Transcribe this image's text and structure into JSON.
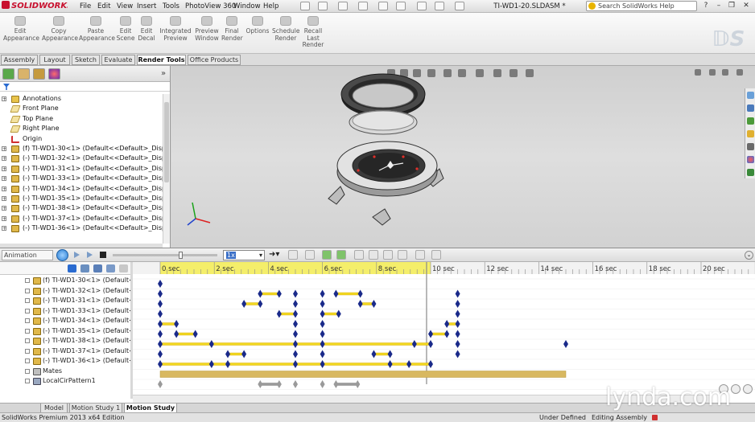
{
  "app": {
    "logo_text": "SOLIDWORKS",
    "document_title": "TI-WD1-20.SLDASM *",
    "help_search_placeholder": "Search SolidWorks Help",
    "menu": [
      "File",
      "Edit",
      "View",
      "Insert",
      "Tools",
      "PhotoView 360",
      "Window",
      "Help"
    ]
  },
  "command_manager": {
    "buttons": [
      {
        "label": "Edit\nAppearance",
        "icon": "edit-appearance-icon"
      },
      {
        "label": "Copy\nAppearance",
        "icon": "copy-appearance-icon"
      },
      {
        "label": "Paste\nAppearance",
        "icon": "paste-appearance-icon"
      },
      {
        "label": "Edit\nScene",
        "icon": "edit-scene-icon"
      },
      {
        "label": "Edit\nDecal",
        "icon": "edit-decal-icon"
      },
      {
        "label": "Integrated\nPreview",
        "icon": "integrated-preview-icon"
      },
      {
        "label": "Preview\nWindow",
        "icon": "preview-window-icon"
      },
      {
        "label": "Final\nRender",
        "icon": "final-render-icon"
      },
      {
        "label": "Options",
        "icon": "options-icon"
      },
      {
        "label": "Schedule\nRender",
        "icon": "schedule-render-icon"
      },
      {
        "label": "Recall\nLast\nRender",
        "icon": "recall-last-render-icon"
      }
    ],
    "tabs": [
      "Assembly",
      "Layout",
      "Sketch",
      "Evaluate",
      "Render Tools",
      "Office Products"
    ],
    "active_tab": "Render Tools"
  },
  "feature_tree": {
    "items": [
      {
        "label": "Annotations",
        "icon": "annotations-icon",
        "expand": "+"
      },
      {
        "label": "Front Plane",
        "icon": "plane-icon",
        "expand": ""
      },
      {
        "label": "Top Plane",
        "icon": "plane-icon",
        "expand": ""
      },
      {
        "label": "Right Plane",
        "icon": "plane-icon",
        "expand": ""
      },
      {
        "label": "Origin",
        "icon": "origin-icon",
        "expand": ""
      },
      {
        "label": "(f) TI-WD1-30<1> (Default<<Default>_Display",
        "icon": "part-icon",
        "expand": "+"
      },
      {
        "label": "(-) TI-WD1-32<1> (Default<<Default>_Display",
        "icon": "part-icon",
        "expand": "+"
      },
      {
        "label": "(-) TI-WD1-31<1> (Default<<Default>_Display",
        "icon": "part-icon",
        "expand": "+"
      },
      {
        "label": "(-) TI-WD1-33<1> (Default<<Default>_Display",
        "icon": "part-icon",
        "expand": "+"
      },
      {
        "label": "(-) TI-WD1-34<1> (Default<<Default>_Display",
        "icon": "part-icon",
        "expand": "+"
      },
      {
        "label": "(-) TI-WD1-35<1> (Default<<Default>_Display",
        "icon": "part-icon",
        "expand": "+"
      },
      {
        "label": "(-) TI-WD1-38<1> (Default<<Default>_Display",
        "icon": "part-icon",
        "expand": "+"
      },
      {
        "label": "(-) TI-WD1-37<1> (Default<<Default>_Display",
        "icon": "part-icon",
        "expand": "+"
      },
      {
        "label": "(-) TI-WD1-36<1> (Default<<Default>_Display",
        "icon": "part-icon",
        "expand": "+"
      }
    ]
  },
  "motion_manager": {
    "study_type": "Animation",
    "playback_speed": "1x",
    "tree": [
      {
        "label": "(f) TI-WD1-30<1> (Default<<",
        "icon": "part-icon"
      },
      {
        "label": "(-) TI-WD1-32<1> (Default<<",
        "icon": "part-icon"
      },
      {
        "label": "(-) TI-WD1-31<1> (Default<<",
        "icon": "part-icon"
      },
      {
        "label": "(-) TI-WD1-33<1> (Default<<",
        "icon": "part-icon"
      },
      {
        "label": "(-) TI-WD1-34<1> (Default<<",
        "icon": "part-icon"
      },
      {
        "label": "(-) TI-WD1-35<1> (Default<<",
        "icon": "part-icon"
      },
      {
        "label": "(-) TI-WD1-38<1> (Default<<",
        "icon": "part-icon"
      },
      {
        "label": "(-) TI-WD1-37<1> (Default<<",
        "icon": "part-icon"
      },
      {
        "label": "(-) TI-WD1-36<1> (Default<<",
        "icon": "part-icon"
      },
      {
        "label": "Mates",
        "icon": "mates-icon"
      },
      {
        "label": "LocalCirPattern1",
        "icon": "pattern-icon"
      }
    ],
    "time_labels": [
      "0 sec",
      "2 sec",
      "4 sec",
      "6 sec",
      "8 sec",
      "10 sec",
      "12 sec",
      "14 sec",
      "16 sec",
      "18 sec",
      "20 sec"
    ],
    "tabs": [
      "Model",
      "Motion Study 1",
      "Motion Study 2"
    ],
    "active_tab": "Motion Study 2"
  },
  "status_bar": {
    "edition": "SolidWorks Premium 2013 x64 Edition",
    "state": "Under Defined",
    "mode": "Editing Assembly"
  },
  "watermark": "lynda.com"
}
